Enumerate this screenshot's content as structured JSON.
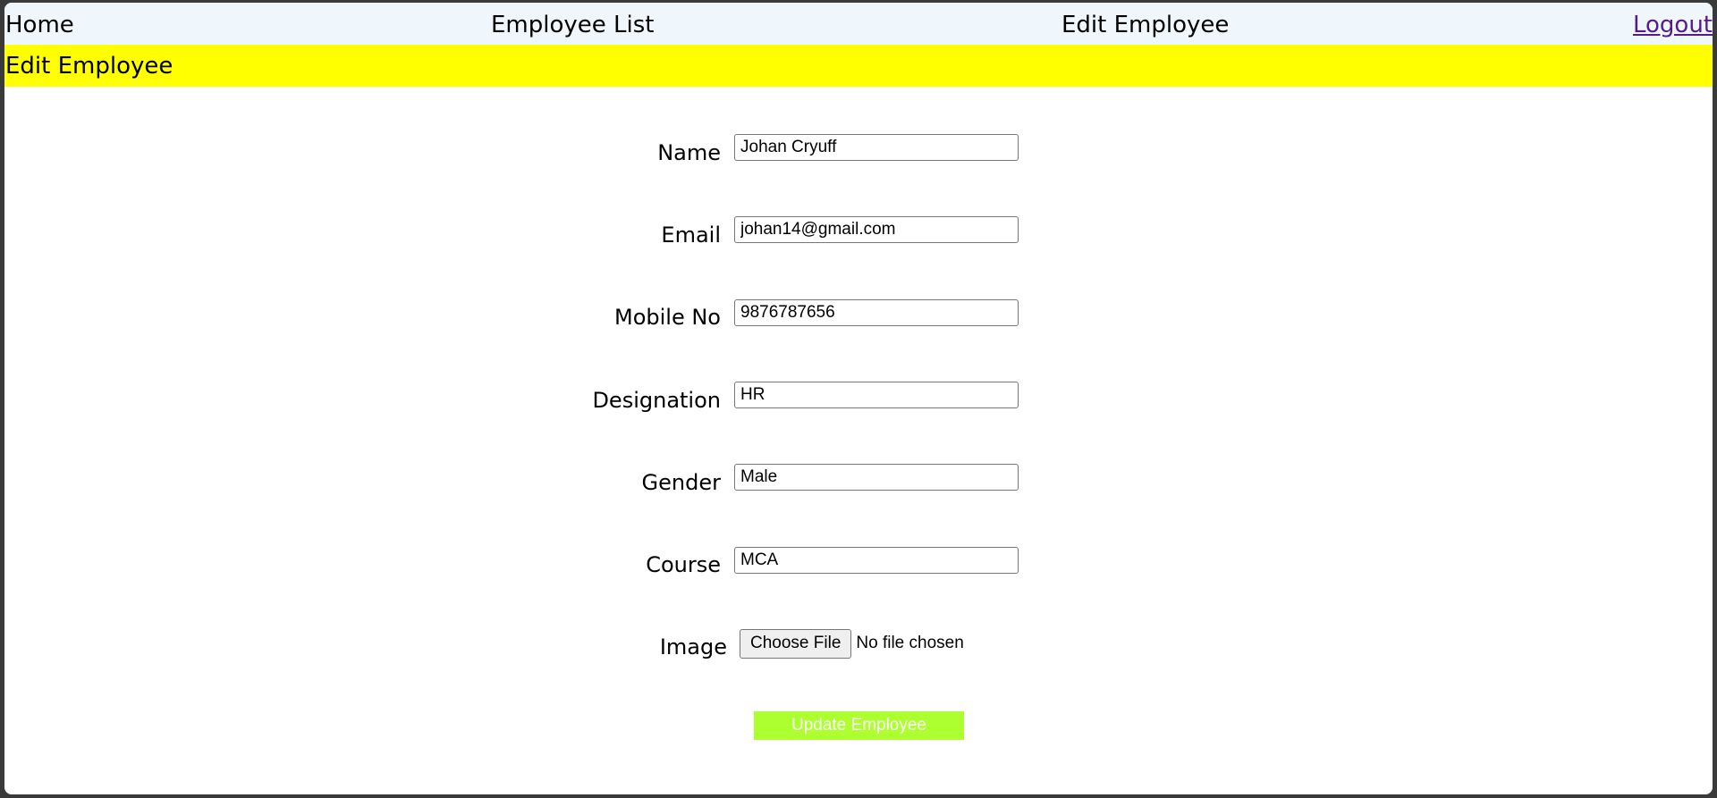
{
  "nav": {
    "home": "Home",
    "employee_list": "Employee List",
    "edit_employee": "Edit Employee",
    "logout": "Logout"
  },
  "banner": {
    "title": "Edit Employee"
  },
  "form": {
    "name": {
      "label": "Name",
      "value": "Johan Cryuff"
    },
    "email": {
      "label": "Email",
      "value": "johan14@gmail.com"
    },
    "mobile": {
      "label": "Mobile No",
      "value": "9876787656"
    },
    "designation": {
      "label": "Designation",
      "value": "HR"
    },
    "gender": {
      "label": "Gender",
      "value": "Male"
    },
    "course": {
      "label": "Course",
      "value": "MCA"
    },
    "image": {
      "label": "Image",
      "button_label": "Choose File",
      "status": "No file chosen"
    },
    "submit_label": "Update Employee"
  },
  "colors": {
    "navbar_bg": "#eff7fc",
    "banner_bg": "#ffff00",
    "update_button_bg": "#adff2f",
    "logout_link": "#551a8b"
  }
}
